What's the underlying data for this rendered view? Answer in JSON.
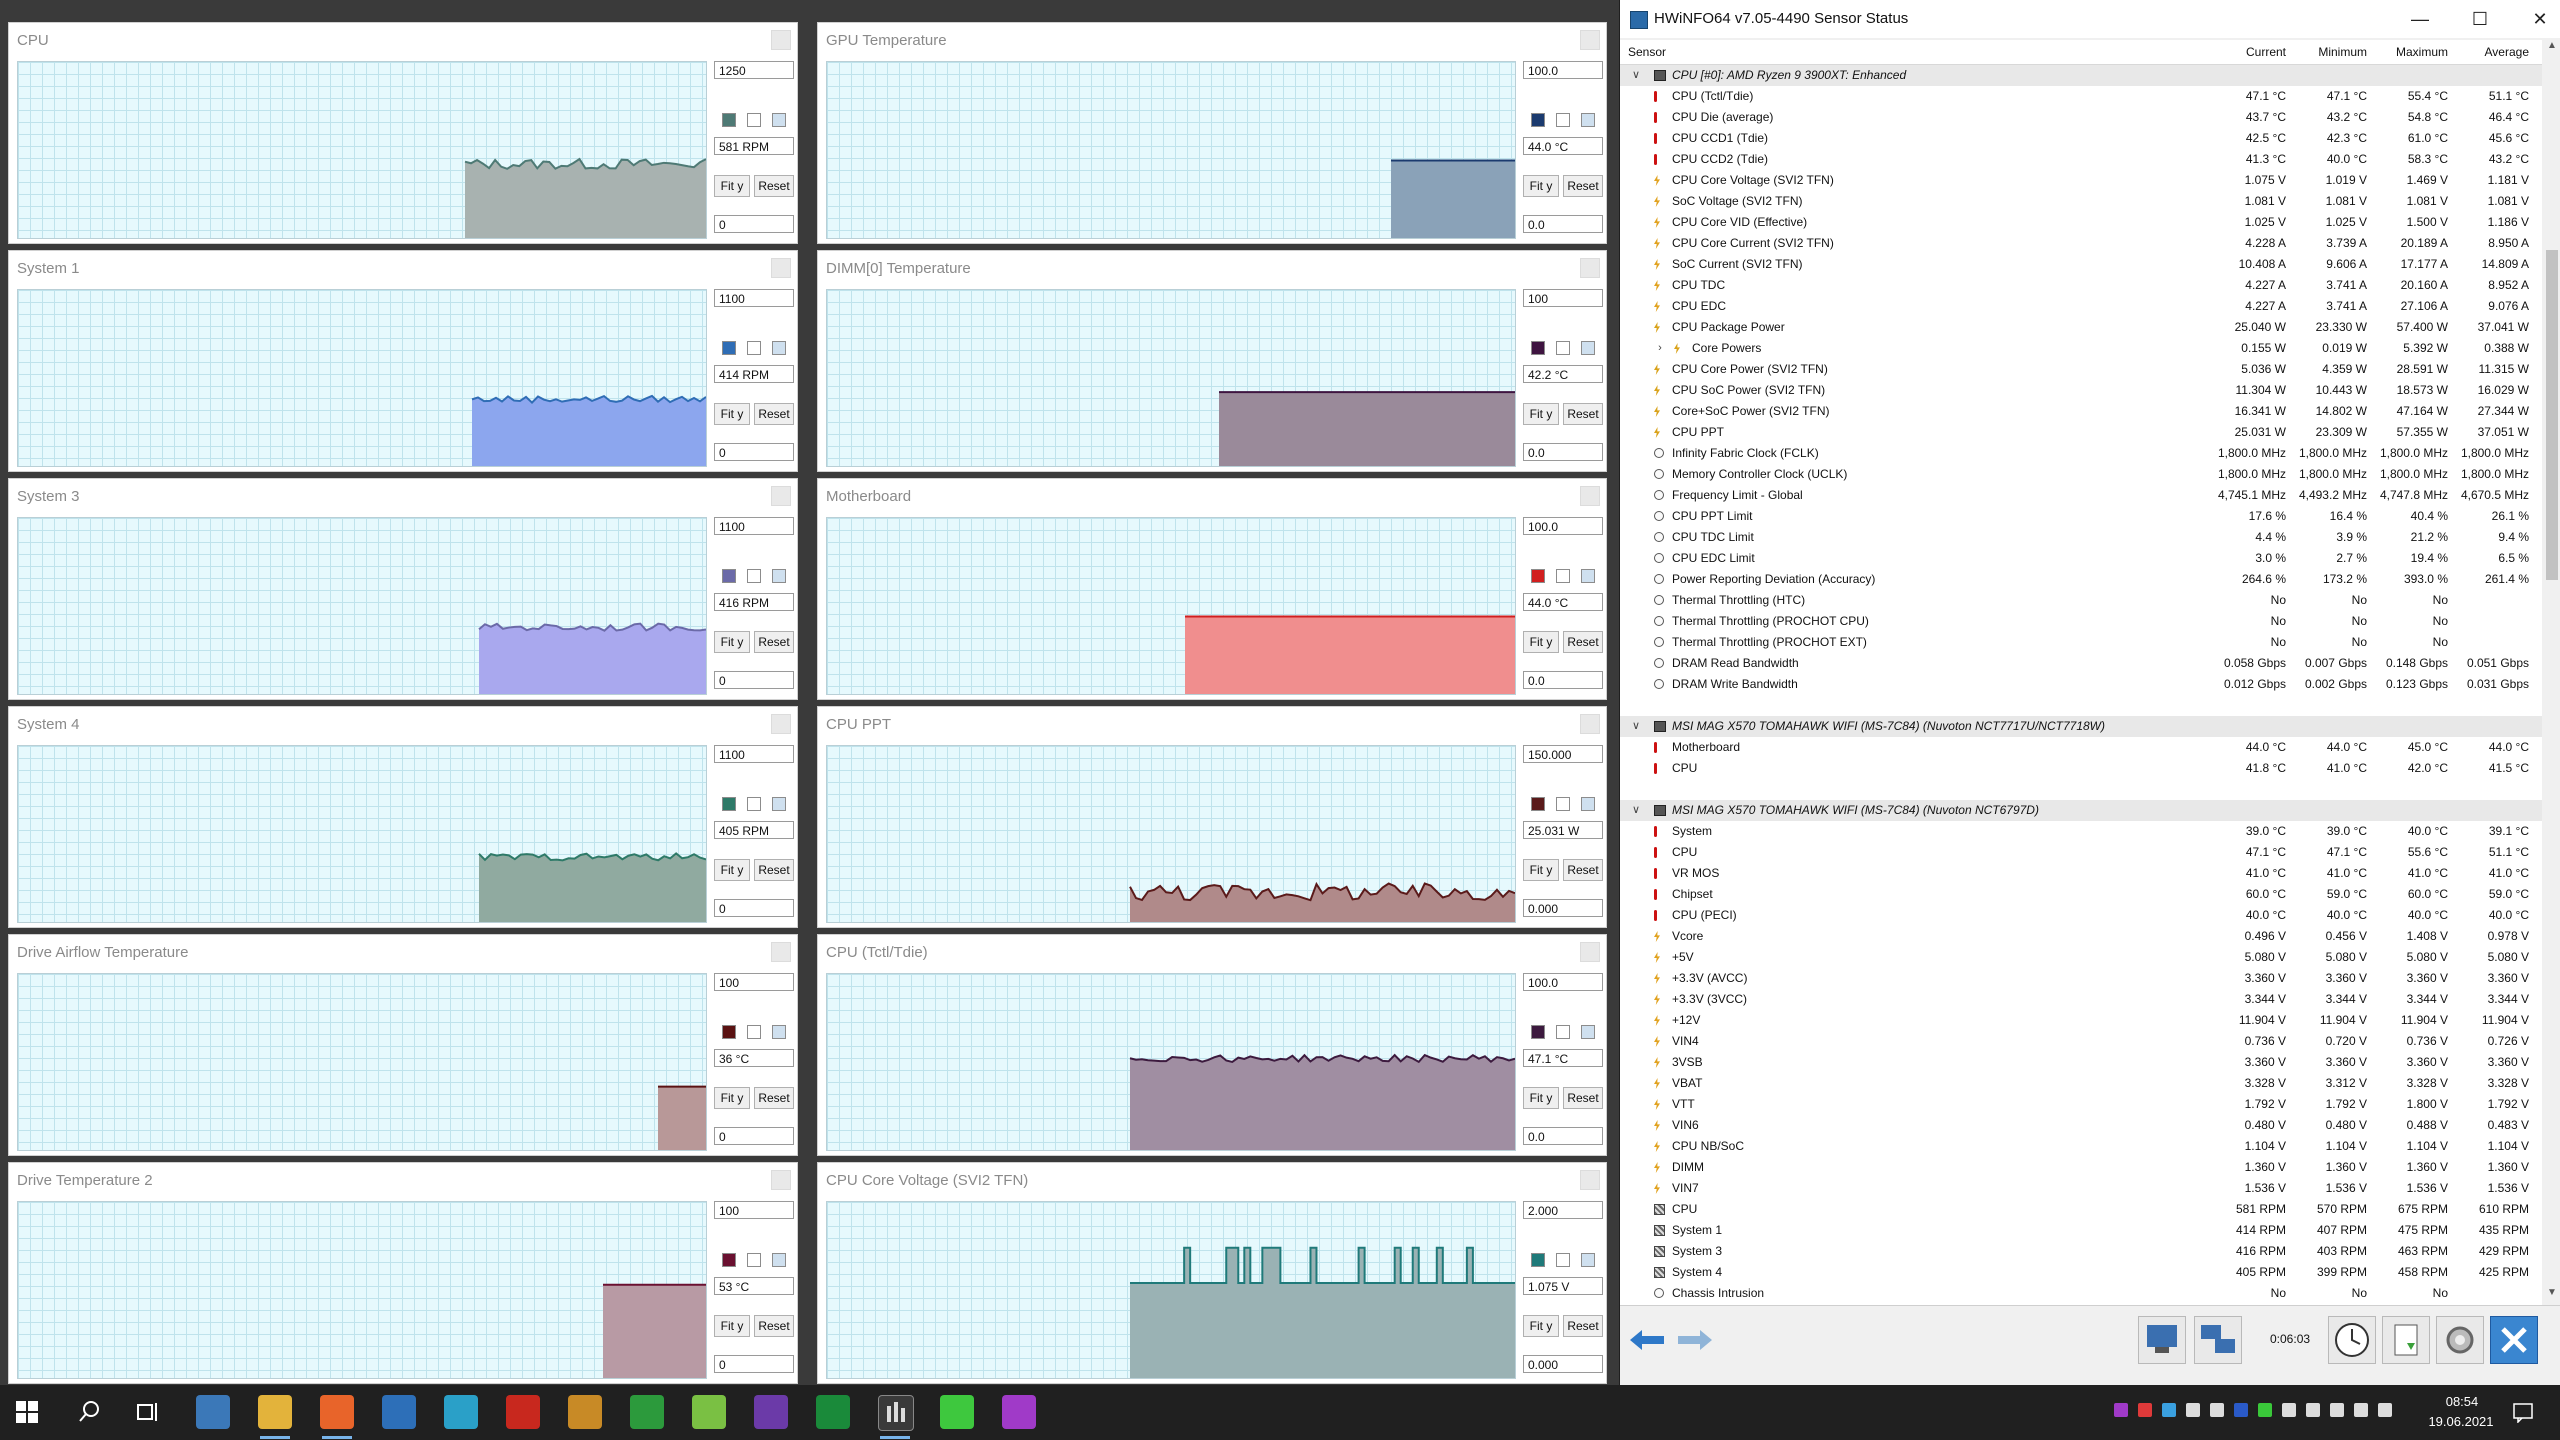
{
  "graphs": [
    {
      "title": "CPU",
      "max": "1250",
      "current": "581 RPM",
      "min": "0",
      "color": "#4e7a75",
      "fill": "#a8b2b0",
      "start": 0.65,
      "level": 0.42,
      "noise": 0.03
    },
    {
      "title": "GPU Temperature",
      "max": "100.0",
      "current": "44.0 °C",
      "min": "0.0",
      "color": "#1b3b6f",
      "fill": "#8aa2b8",
      "start": 0.82,
      "level": 0.44,
      "noise": 0.0
    },
    {
      "title": "System 1",
      "max": "1100",
      "current": "414 RPM",
      "min": "0",
      "color": "#2f6db5",
      "fill": "#8ca6ee",
      "start": 0.66,
      "level": 0.38,
      "noise": 0.02
    },
    {
      "title": "DIMM[0] Temperature",
      "max": "100",
      "current": "42.2 °C",
      "min": "0.0",
      "color": "#3e1440",
      "fill": "#9a8a9a",
      "start": 0.57,
      "level": 0.42,
      "noise": 0.0
    },
    {
      "title": "System 3",
      "max": "1100",
      "current": "416 RPM",
      "min": "0",
      "color": "#6b6aa8",
      "fill": "#a9a8ee",
      "start": 0.67,
      "level": 0.38,
      "noise": 0.02
    },
    {
      "title": "Motherboard",
      "max": "100.0",
      "current": "44.0 °C",
      "min": "0.0",
      "color": "#d11f1f",
      "fill": "#f08e8e",
      "start": 0.52,
      "level": 0.44,
      "noise": 0.0
    },
    {
      "title": "System 4",
      "max": "1100",
      "current": "405 RPM",
      "min": "0",
      "color": "#2e7a68",
      "fill": "#90aaa0",
      "start": 0.67,
      "level": 0.37,
      "noise": 0.02
    },
    {
      "title": "CPU PPT",
      "max": "150.000",
      "current": "25.031 W",
      "min": "0.000",
      "color": "#5a1a1a",
      "fill": "#b08a8a",
      "start": 0.44,
      "level": 0.17,
      "noise": 0.05
    },
    {
      "title": "Drive Airflow Temperature",
      "max": "100",
      "current": "36 °C",
      "min": "0",
      "color": "#5a1212",
      "fill": "#b89898",
      "start": 0.93,
      "level": 0.36,
      "noise": 0.0
    },
    {
      "title": "CPU (Tctl/Tdie)",
      "max": "100.0",
      "current": "47.1 °C",
      "min": "0.0",
      "color": "#3c1a3e",
      "fill": "#a08ea2",
      "start": 0.44,
      "level": 0.52,
      "noise": 0.02
    },
    {
      "title": "Drive Temperature 2",
      "max": "100",
      "current": "53 °C",
      "min": "0",
      "color": "#6a1030",
      "fill": "#b89aa4",
      "start": 0.85,
      "level": 0.53,
      "noise": 0.0
    },
    {
      "title": "CPU Core Voltage (SVI2 TFN)",
      "max": "2.000",
      "current": "1.075 V",
      "min": "0.000",
      "color": "#1f7a7a",
      "fill": "#9ab2b4",
      "start": 0.44,
      "level": 0.54,
      "noise": 0.0,
      "spiky": true
    }
  ],
  "buttons": {
    "fit": "Fit y",
    "reset": "Reset"
  },
  "hwinfo": {
    "title": "HWiNFO64 v7.05-4490 Sensor Status",
    "columns": {
      "sensor": "Sensor",
      "current": "Current",
      "minimum": "Minimum",
      "maximum": "Maximum",
      "average": "Average"
    },
    "rows": [
      {
        "type": "group",
        "label": "CPU [#0]: AMD Ryzen 9 3900XT: Enhanced"
      },
      {
        "icon": "therm",
        "label": "CPU (Tctl/Tdie)",
        "cur": "47.1 °C",
        "min": "47.1 °C",
        "max": "55.4 °C",
        "avg": "51.1 °C"
      },
      {
        "icon": "therm",
        "label": "CPU Die (average)",
        "cur": "43.7 °C",
        "min": "43.2 °C",
        "max": "54.8 °C",
        "avg": "46.4 °C"
      },
      {
        "icon": "therm",
        "label": "CPU CCD1 (Tdie)",
        "cur": "42.5 °C",
        "min": "42.3 °C",
        "max": "61.0 °C",
        "avg": "45.6 °C"
      },
      {
        "icon": "therm",
        "label": "CPU CCD2 (Tdie)",
        "cur": "41.3 °C",
        "min": "40.0 °C",
        "max": "58.3 °C",
        "avg": "43.2 °C"
      },
      {
        "icon": "volt",
        "label": "CPU Core Voltage (SVI2 TFN)",
        "cur": "1.075 V",
        "min": "1.019 V",
        "max": "1.469 V",
        "avg": "1.181 V"
      },
      {
        "icon": "volt",
        "label": "SoC Voltage (SVI2 TFN)",
        "cur": "1.081 V",
        "min": "1.081 V",
        "max": "1.081 V",
        "avg": "1.081 V"
      },
      {
        "icon": "volt",
        "label": "CPU Core VID (Effective)",
        "cur": "1.025 V",
        "min": "1.025 V",
        "max": "1.500 V",
        "avg": "1.186 V"
      },
      {
        "icon": "volt",
        "label": "CPU Core Current (SVI2 TFN)",
        "cur": "4.228 A",
        "min": "3.739 A",
        "max": "20.189 A",
        "avg": "8.950 A"
      },
      {
        "icon": "volt",
        "label": "SoC Current (SVI2 TFN)",
        "cur": "10.408 A",
        "min": "9.606 A",
        "max": "17.177 A",
        "avg": "14.809 A"
      },
      {
        "icon": "volt",
        "label": "CPU TDC",
        "cur": "4.227 A",
        "min": "3.741 A",
        "max": "20.160 A",
        "avg": "8.952 A"
      },
      {
        "icon": "volt",
        "label": "CPU EDC",
        "cur": "4.227 A",
        "min": "3.741 A",
        "max": "27.106 A",
        "avg": "9.076 A"
      },
      {
        "icon": "power",
        "label": "CPU Package Power",
        "cur": "25.040 W",
        "min": "23.330 W",
        "max": "57.400 W",
        "avg": "37.041 W"
      },
      {
        "icon": "power",
        "label": "Core Powers",
        "cur": "0.155 W",
        "min": "0.019 W",
        "max": "5.392 W",
        "avg": "0.388 W",
        "sub": true
      },
      {
        "icon": "power",
        "label": "CPU Core Power (SVI2 TFN)",
        "cur": "5.036 W",
        "min": "4.359 W",
        "max": "28.591 W",
        "avg": "11.315 W"
      },
      {
        "icon": "power",
        "label": "CPU SoC Power (SVI2 TFN)",
        "cur": "11.304 W",
        "min": "10.443 W",
        "max": "18.573 W",
        "avg": "16.029 W"
      },
      {
        "icon": "power",
        "label": "Core+SoC Power (SVI2 TFN)",
        "cur": "16.341 W",
        "min": "14.802 W",
        "max": "47.164 W",
        "avg": "27.344 W"
      },
      {
        "icon": "power",
        "label": "CPU PPT",
        "cur": "25.031 W",
        "min": "23.309 W",
        "max": "57.355 W",
        "avg": "37.051 W"
      },
      {
        "icon": "clock",
        "label": "Infinity Fabric Clock (FCLK)",
        "cur": "1,800.0 MHz",
        "min": "1,800.0 MHz",
        "max": "1,800.0 MHz",
        "avg": "1,800.0 MHz"
      },
      {
        "icon": "clock",
        "label": "Memory Controller Clock (UCLK)",
        "cur": "1,800.0 MHz",
        "min": "1,800.0 MHz",
        "max": "1,800.0 MHz",
        "avg": "1,800.0 MHz"
      },
      {
        "icon": "clock",
        "label": "Frequency Limit - Global",
        "cur": "4,745.1 MHz",
        "min": "4,493.2 MHz",
        "max": "4,747.8 MHz",
        "avg": "4,670.5 MHz"
      },
      {
        "icon": "clock",
        "label": "CPU PPT Limit",
        "cur": "17.6 %",
        "min": "16.4 %",
        "max": "40.4 %",
        "avg": "26.1 %"
      },
      {
        "icon": "clock",
        "label": "CPU TDC Limit",
        "cur": "4.4 %",
        "min": "3.9 %",
        "max": "21.2 %",
        "avg": "9.4 %"
      },
      {
        "icon": "clock",
        "label": "CPU EDC Limit",
        "cur": "3.0 %",
        "min": "2.7 %",
        "max": "19.4 %",
        "avg": "6.5 %"
      },
      {
        "icon": "clock",
        "label": "Power Reporting Deviation (Accuracy)",
        "cur": "264.6 %",
        "min": "173.2 %",
        "max": "393.0 %",
        "avg": "261.4 %"
      },
      {
        "icon": "clock",
        "label": "Thermal Throttling (HTC)",
        "cur": "No",
        "min": "No",
        "max": "No",
        "avg": ""
      },
      {
        "icon": "clock",
        "label": "Thermal Throttling (PROCHOT CPU)",
        "cur": "No",
        "min": "No",
        "max": "No",
        "avg": ""
      },
      {
        "icon": "clock",
        "label": "Thermal Throttling (PROCHOT EXT)",
        "cur": "No",
        "min": "No",
        "max": "No",
        "avg": ""
      },
      {
        "icon": "clock",
        "label": "DRAM Read Bandwidth",
        "cur": "0.058 Gbps",
        "min": "0.007 Gbps",
        "max": "0.148 Gbps",
        "avg": "0.051 Gbps"
      },
      {
        "icon": "clock",
        "label": "DRAM Write Bandwidth",
        "cur": "0.012 Gbps",
        "min": "0.002 Gbps",
        "max": "0.123 Gbps",
        "avg": "0.031 Gbps"
      },
      {
        "type": "spacer"
      },
      {
        "type": "group",
        "label": "MSI MAG X570 TOMAHAWK WIFI (MS-7C84) (Nuvoton NCT7717U/NCT7718W)"
      },
      {
        "icon": "therm",
        "label": "Motherboard",
        "cur": "44.0 °C",
        "min": "44.0 °C",
        "max": "45.0 °C",
        "avg": "44.0 °C"
      },
      {
        "icon": "therm",
        "label": "CPU",
        "cur": "41.8 °C",
        "min": "41.0 °C",
        "max": "42.0 °C",
        "avg": "41.5 °C"
      },
      {
        "type": "spacer"
      },
      {
        "type": "group",
        "label": "MSI MAG X570 TOMAHAWK WIFI (MS-7C84) (Nuvoton NCT6797D)"
      },
      {
        "icon": "therm",
        "label": "System",
        "cur": "39.0 °C",
        "min": "39.0 °C",
        "max": "40.0 °C",
        "avg": "39.1 °C"
      },
      {
        "icon": "therm",
        "label": "CPU",
        "cur": "47.1 °C",
        "min": "47.1 °C",
        "max": "55.6 °C",
        "avg": "51.1 °C"
      },
      {
        "icon": "therm",
        "label": "VR MOS",
        "cur": "41.0 °C",
        "min": "41.0 °C",
        "max": "41.0 °C",
        "avg": "41.0 °C"
      },
      {
        "icon": "therm",
        "label": "Chipset",
        "cur": "60.0 °C",
        "min": "59.0 °C",
        "max": "60.0 °C",
        "avg": "59.0 °C"
      },
      {
        "icon": "therm",
        "label": "CPU (PECI)",
        "cur": "40.0 °C",
        "min": "40.0 °C",
        "max": "40.0 °C",
        "avg": "40.0 °C"
      },
      {
        "icon": "volt",
        "label": "Vcore",
        "cur": "0.496 V",
        "min": "0.456 V",
        "max": "1.408 V",
        "avg": "0.978 V"
      },
      {
        "icon": "volt",
        "label": "+5V",
        "cur": "5.080 V",
        "min": "5.080 V",
        "max": "5.080 V",
        "avg": "5.080 V"
      },
      {
        "icon": "volt",
        "label": "+3.3V (AVCC)",
        "cur": "3.360 V",
        "min": "3.360 V",
        "max": "3.360 V",
        "avg": "3.360 V"
      },
      {
        "icon": "volt",
        "label": "+3.3V (3VCC)",
        "cur": "3.344 V",
        "min": "3.344 V",
        "max": "3.344 V",
        "avg": "3.344 V"
      },
      {
        "icon": "volt",
        "label": "+12V",
        "cur": "11.904 V",
        "min": "11.904 V",
        "max": "11.904 V",
        "avg": "11.904 V"
      },
      {
        "icon": "volt",
        "label": "VIN4",
        "cur": "0.736 V",
        "min": "0.720 V",
        "max": "0.736 V",
        "avg": "0.726 V"
      },
      {
        "icon": "volt",
        "label": "3VSB",
        "cur": "3.360 V",
        "min": "3.360 V",
        "max": "3.360 V",
        "avg": "3.360 V"
      },
      {
        "icon": "volt",
        "label": "VBAT",
        "cur": "3.328 V",
        "min": "3.312 V",
        "max": "3.328 V",
        "avg": "3.328 V"
      },
      {
        "icon": "volt",
        "label": "VTT",
        "cur": "1.792 V",
        "min": "1.792 V",
        "max": "1.800 V",
        "avg": "1.792 V"
      },
      {
        "icon": "volt",
        "label": "VIN6",
        "cur": "0.480 V",
        "min": "0.480 V",
        "max": "0.488 V",
        "avg": "0.483 V"
      },
      {
        "icon": "volt",
        "label": "CPU NB/SoC",
        "cur": "1.104 V",
        "min": "1.104 V",
        "max": "1.104 V",
        "avg": "1.104 V"
      },
      {
        "icon": "volt",
        "label": "DIMM",
        "cur": "1.360 V",
        "min": "1.360 V",
        "max": "1.360 V",
        "avg": "1.360 V"
      },
      {
        "icon": "volt",
        "label": "VIN7",
        "cur": "1.536 V",
        "min": "1.536 V",
        "max": "1.536 V",
        "avg": "1.536 V"
      },
      {
        "icon": "fan",
        "label": "CPU",
        "cur": "581 RPM",
        "min": "570 RPM",
        "max": "675 RPM",
        "avg": "610 RPM"
      },
      {
        "icon": "fan",
        "label": "System 1",
        "cur": "414 RPM",
        "min": "407 RPM",
        "max": "475 RPM",
        "avg": "435 RPM"
      },
      {
        "icon": "fan",
        "label": "System 3",
        "cur": "416 RPM",
        "min": "403 RPM",
        "max": "463 RPM",
        "avg": "429 RPM"
      },
      {
        "icon": "fan",
        "label": "System 4",
        "cur": "405 RPM",
        "min": "399 RPM",
        "max": "458 RPM",
        "avg": "425 RPM"
      },
      {
        "icon": "clock",
        "label": "Chassis Intrusion",
        "cur": "No",
        "min": "No",
        "max": "No",
        "avg": ""
      }
    ],
    "elapsed": "0:06:03"
  },
  "taskbar": {
    "time": "08:54",
    "date": "19.06.2021",
    "apps": [
      {
        "name": "calculator-icon",
        "color": "#3b78b8"
      },
      {
        "name": "file-explorer-icon",
        "color": "#e3b33b"
      },
      {
        "name": "firefox-icon",
        "color": "#e8642a"
      },
      {
        "name": "thunderbird-icon",
        "color": "#2d6fb8"
      },
      {
        "name": "app-blue-circle-icon",
        "color": "#2aa0c8"
      },
      {
        "name": "pdf-reader-icon",
        "color": "#c8281e"
      },
      {
        "name": "gimp-icon",
        "color": "#c88a26"
      },
      {
        "name": "inkscape-icon",
        "color": "#2c9a3c"
      },
      {
        "name": "android-app-icon",
        "color": "#7ac043"
      },
      {
        "name": "cpu-app-icon",
        "color": "#6b3aa8"
      },
      {
        "name": "zen-app-icon",
        "color": "#1a8a3a"
      },
      {
        "name": "hwinfo-taskbar-icon",
        "color": "#dddddd"
      },
      {
        "name": "gpu-app-icon",
        "color": "#3ec83e"
      },
      {
        "name": "camera-app-icon",
        "color": "#a03ac8"
      }
    ]
  }
}
